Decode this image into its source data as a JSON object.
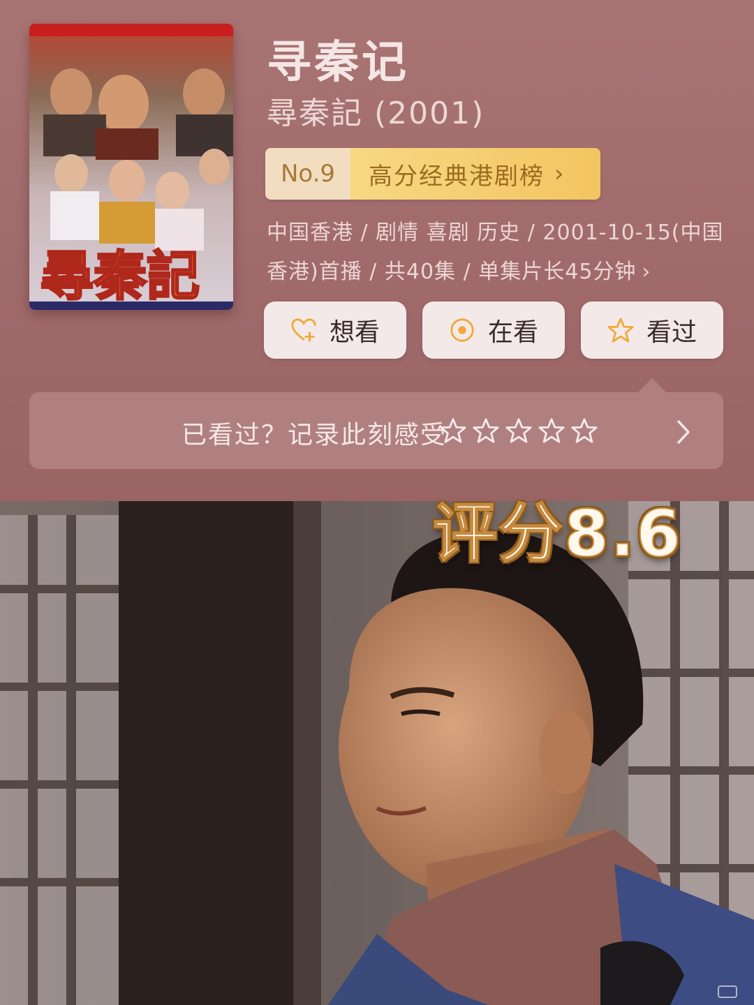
{
  "show": {
    "title": "寻秦记",
    "original_title": "尋秦記 (2001)"
  },
  "ranking": {
    "number": "No.9",
    "list_name": "高分经典港剧榜",
    "arrow": "›"
  },
  "meta": {
    "line1": "中国香港 / 剧情 喜剧 历史 / 2001-10-15(中国",
    "line2": "香港)首播 / 共40集 / 单集片长45分钟",
    "arrow": "›"
  },
  "actions": [
    {
      "label": "想看",
      "icon": "heart-plus-icon"
    },
    {
      "label": "在看",
      "icon": "record-circle-icon"
    },
    {
      "label": "看过",
      "icon": "star-outline-icon"
    }
  ],
  "rating_prompt": {
    "text": "已看过？记录此刻感受",
    "star_count": 5
  },
  "overlay": {
    "score_text": "评分8.6"
  },
  "poster": {
    "title_text": "尋秦記"
  },
  "colors": {
    "panel_bg": "#a06a6b",
    "rank_gold": "#f3c561",
    "rank_text": "#9a6c22",
    "action_icon": "#f0a93a",
    "button_bg": "#f3e9e8"
  }
}
